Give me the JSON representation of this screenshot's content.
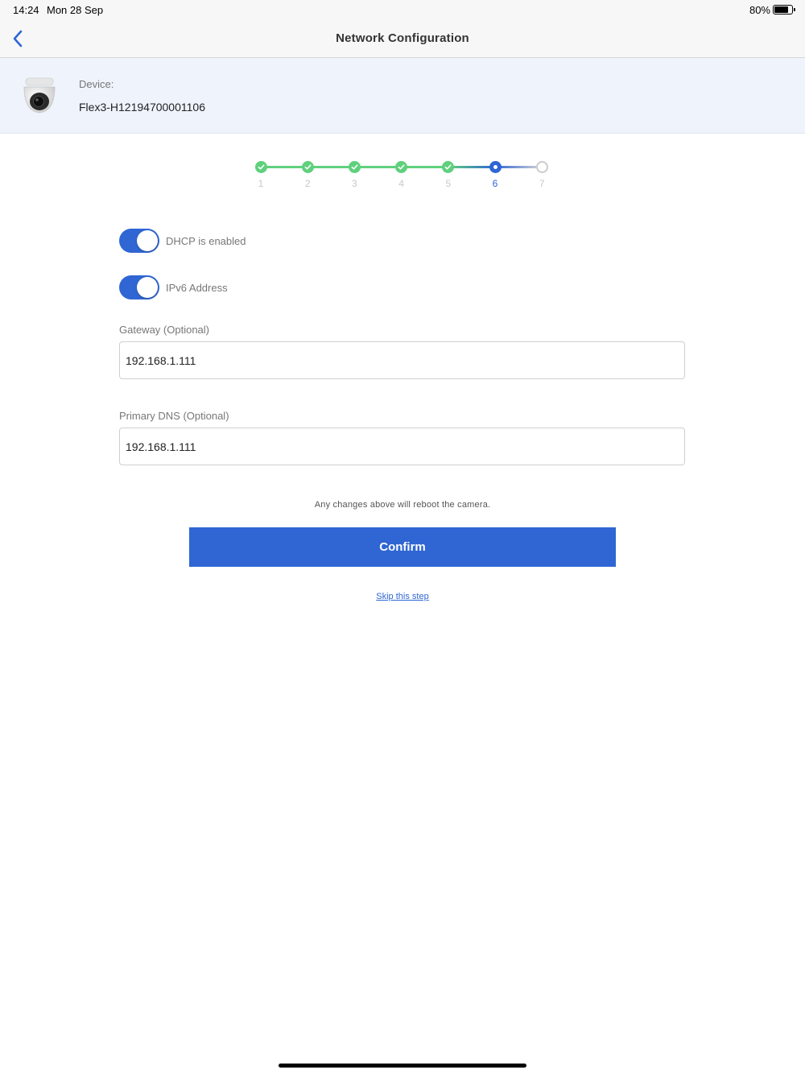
{
  "status_bar": {
    "time": "14:24",
    "date": "Mon 28 Sep",
    "battery_percent": "80%",
    "battery_level": 0.8
  },
  "nav": {
    "title": "Network Configuration",
    "back_icon": "chevron-left-icon"
  },
  "device": {
    "label": "Device:",
    "name": "Flex3-H12194700001106",
    "icon": "dome-camera-icon"
  },
  "stepper": {
    "current_step": 6,
    "steps": [
      {
        "label": "1",
        "status": "done"
      },
      {
        "label": "2",
        "status": "done"
      },
      {
        "label": "3",
        "status": "done"
      },
      {
        "label": "4",
        "status": "done"
      },
      {
        "label": "5",
        "status": "done"
      },
      {
        "label": "6",
        "status": "current"
      },
      {
        "label": "7",
        "status": "pending"
      }
    ]
  },
  "toggles": {
    "dhcp": {
      "label": "DHCP is enabled",
      "on": true
    },
    "ipv6": {
      "label": "IPv6 Address",
      "on": true
    }
  },
  "fields": {
    "gateway": {
      "label": "Gateway (Optional)",
      "value": "192.168.1.111"
    },
    "primary_dns": {
      "label": "Primary DNS (Optional)",
      "value": "192.168.1.111"
    }
  },
  "note": "Any changes above will reboot the camera.",
  "confirm_label": "Confirm",
  "skip_label": "Skip this step",
  "colors": {
    "accent": "#2f66d4",
    "success": "#5fd07c",
    "device_panel_bg": "#eef3fc"
  }
}
